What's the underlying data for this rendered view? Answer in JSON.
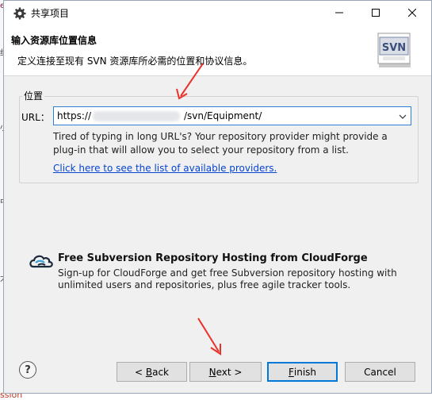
{
  "window": {
    "title": "共享项目"
  },
  "banner": {
    "title": "输入资源库位置信息",
    "description": "定义连接至现有 SVN 资源库所必需的位置和协议信息。",
    "logo_text": "SVN"
  },
  "location": {
    "group_label": "位置",
    "url_label": "URL：",
    "url_prefix": "https://",
    "url_suffix": "/svn/Equipment/",
    "help_text": "Tired of typing in long URL's?  Your repository provider might provide a plug-in that will allow you to select your repository from a list.",
    "providers_link": "Click here to see the list of available providers."
  },
  "cloudforge": {
    "title": "Free Subversion Repository Hosting from CloudForge",
    "description": "Sign-up for CloudForge and get free Subversion repository hosting with unlimited users and repositories, plus free agile tracker tools."
  },
  "buttons": {
    "help": "?",
    "back_prefix": "< ",
    "back_key": "B",
    "back_rest": "ack",
    "next_key": "N",
    "next_rest": "ext >",
    "finish_key": "F",
    "finish_rest": "inish",
    "cancel": "Cancel"
  },
  "background_fragments": {
    "t1": "e",
    "t2": "约",
    "t3": "小",
    "t4": "中",
    "t5": "大",
    "bottom": "ssion"
  },
  "colors": {
    "accent": "#0078d7",
    "link": "#0645d0",
    "annotation_arrow": "#e8322a"
  },
  "icons": {
    "app": "gear-icon",
    "minimize": "minimize-icon",
    "maximize": "maximize-icon",
    "close": "close-icon",
    "dropdown": "chevron-down-icon",
    "cloudforge": "cloudforge-icon",
    "help": "help-icon"
  }
}
